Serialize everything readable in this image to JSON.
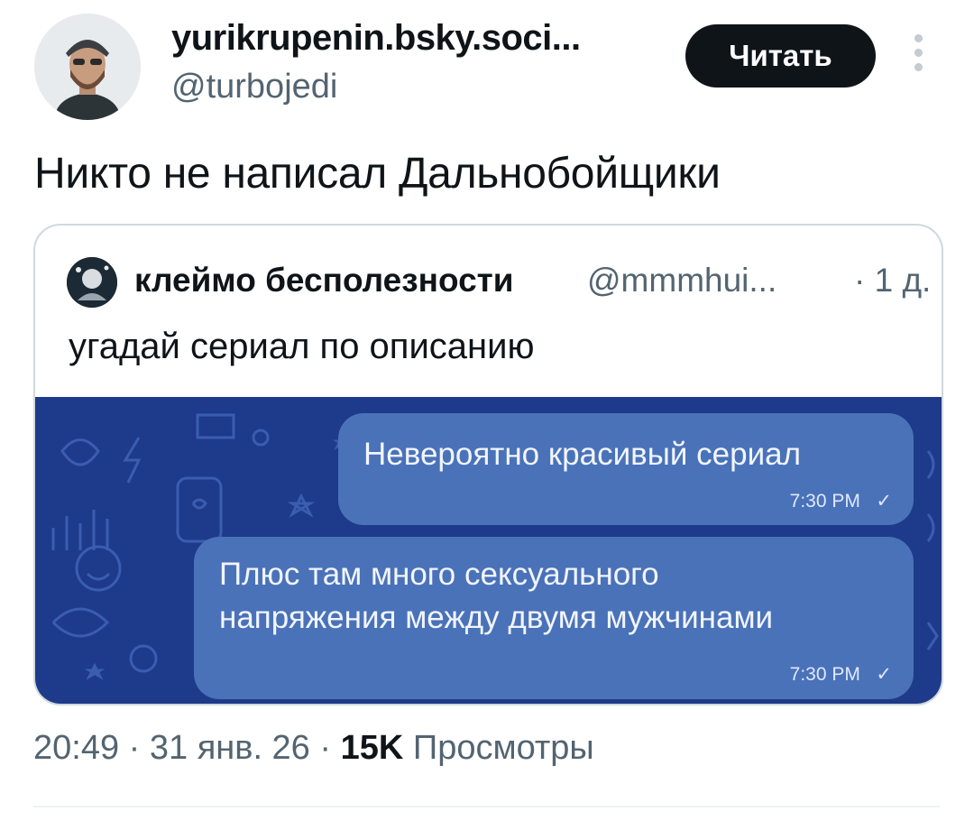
{
  "tweet": {
    "author_display_name": "yurikrupenin.bsky.soci...",
    "author_handle": "@turbojedi",
    "follow_label": "Читать",
    "text": "Никто не написал Дальнобойщики",
    "timestamp": "20:49 · 31 янв. 26 ·",
    "views_count": "15K",
    "views_label": "Просмотры"
  },
  "quote": {
    "author_display_name": "клеймо бесполезности",
    "author_handle": "@mmmhui...",
    "time_ago": "· 1 д.",
    "text": "угадай сериал по описанию",
    "image": {
      "messages": [
        {
          "text": [
            "Невероятно красивый сериал"
          ],
          "time": "7:30 PM"
        },
        {
          "text": [
            "Плюс там много сексуального",
            "напряжения между двумя мужчинами"
          ],
          "time": "7:30 PM"
        }
      ]
    }
  },
  "colors": {
    "text_primary": "#0f1419",
    "text_secondary": "#536471",
    "button_bg": "#0f1419",
    "chat_background": "#1e3a8a",
    "chat_bubble": "#4a72b8"
  },
  "icons": [
    "more-vertical-icon",
    "read-check-icon"
  ]
}
